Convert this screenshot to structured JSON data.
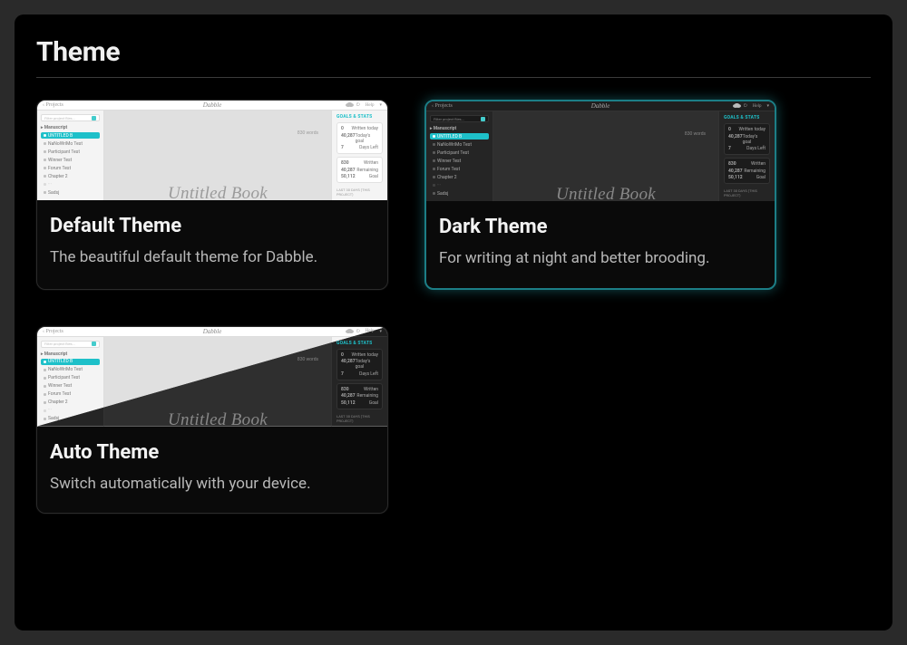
{
  "section_title": "Theme",
  "cards": {
    "default": {
      "title": "Default Theme",
      "desc": "The beautiful default theme for Dabble."
    },
    "dark": {
      "title": "Dark Theme",
      "desc": "For writing at night and better brooding."
    },
    "auto": {
      "title": "Auto Theme",
      "desc": "Switch automatically with your device."
    }
  },
  "preview": {
    "app_name": "Dabble",
    "projects_label": "Projects",
    "help_label": "Help",
    "filter_placeholder": "Filter project files...",
    "manuscript_label": "Manuscript",
    "item_untitled": "UNTITLED B",
    "item_nano": "NaNoWriMo Test",
    "item_participant": "Participant Test",
    "item_winner": "Winner Test",
    "item_forum": "Forum Test",
    "item_chapter": "Chapter 2",
    "item_sadsj": "Sadsj",
    "word_count": "830 words",
    "book_title": "Untitled Book",
    "goals_label": "GOALS & STATS",
    "g_written": "Written today",
    "g_written_v": "0",
    "g_goal": "Today's goal",
    "g_goal_v": "40,287",
    "g_days": "Days Left",
    "g_days_v": "7",
    "s_written": "Written",
    "s_written_v": "830",
    "s_remain": "Remaining",
    "s_remain_v": "40,287",
    "s_goal": "Goal",
    "s_goal_v": "50,112",
    "foot": "LAST 30 DAYS (THIS PROJECT)"
  }
}
